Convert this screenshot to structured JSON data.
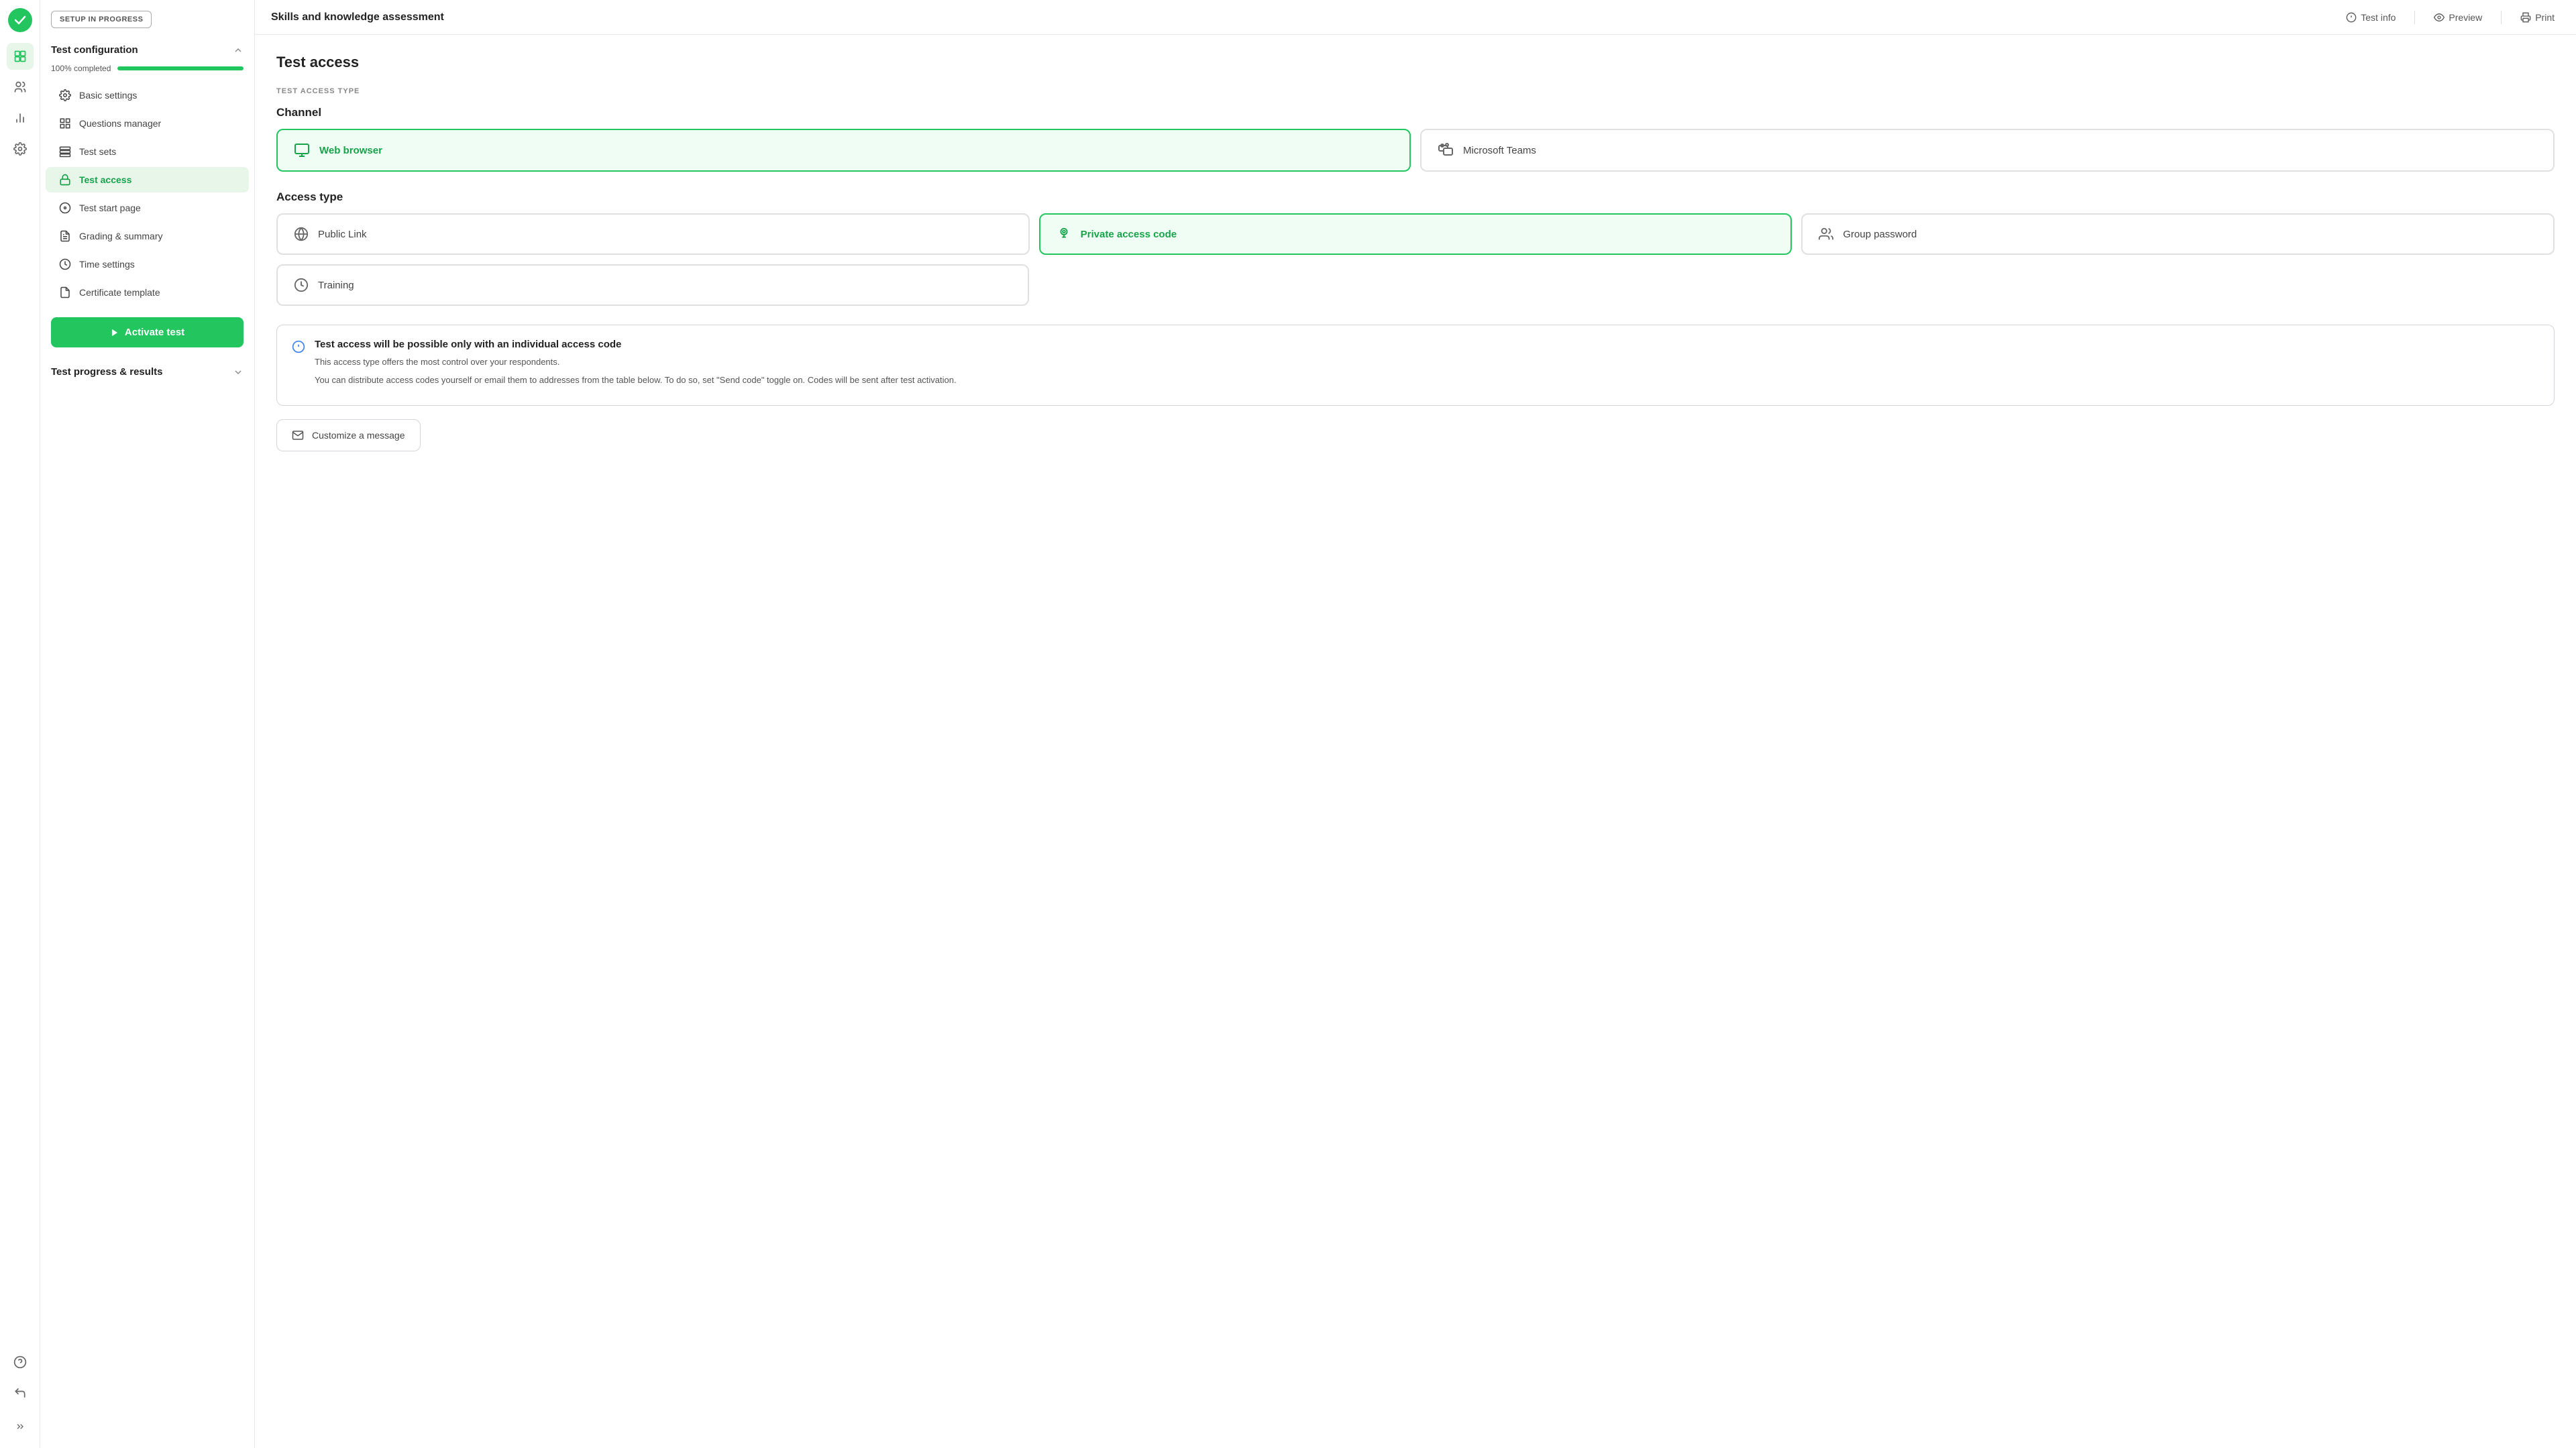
{
  "app": {
    "logo_alt": "Logo checkmark"
  },
  "topbar": {
    "title": "Skills and knowledge assessment",
    "test_info_label": "Test info",
    "preview_label": "Preview",
    "print_label": "Print"
  },
  "sidebar": {
    "setup_badge": "SETUP IN PROGRESS",
    "test_config_title": "Test configuration",
    "progress_label": "100% completed",
    "progress_pct": 100,
    "nav_items": [
      {
        "id": "basic-settings",
        "label": "Basic settings"
      },
      {
        "id": "questions-manager",
        "label": "Questions manager"
      },
      {
        "id": "test-sets",
        "label": "Test sets"
      },
      {
        "id": "test-access",
        "label": "Test access",
        "active": true
      },
      {
        "id": "test-start-page",
        "label": "Test start page"
      },
      {
        "id": "grading-summary",
        "label": "Grading & summary"
      },
      {
        "id": "time-settings",
        "label": "Time settings"
      },
      {
        "id": "certificate-template",
        "label": "Certificate template"
      }
    ],
    "activate_btn_label": "Activate test",
    "test_progress_title": "Test progress & results"
  },
  "main": {
    "page_title": "Test access",
    "section_label": "TEST ACCESS TYPE",
    "channel_label": "Channel",
    "channels": [
      {
        "id": "web-browser",
        "label": "Web browser",
        "selected": true
      },
      {
        "id": "microsoft-teams",
        "label": "Microsoft Teams",
        "selected": false
      }
    ],
    "access_type_label": "Access type",
    "access_types_row1": [
      {
        "id": "public-link",
        "label": "Public Link",
        "selected": false
      },
      {
        "id": "private-access-code",
        "label": "Private access code",
        "selected": true
      },
      {
        "id": "group-password",
        "label": "Group password",
        "selected": false
      }
    ],
    "access_types_row2": [
      {
        "id": "training",
        "label": "Training",
        "selected": false
      }
    ],
    "info_box": {
      "title": "Test access will be possible only with an individual access code",
      "text1": "This access type offers the most control over your respondents.",
      "text2": "You can distribute access codes yourself or email them to addresses from the table below. To do so, set \"Send code\" toggle on. Codes will be sent after test activation."
    },
    "customize_btn_label": "Customize a message"
  },
  "icons": {
    "grid": "⊞",
    "users": "👥",
    "chart": "📊",
    "settings": "⚙",
    "question": "?",
    "back": "←",
    "expand": "»",
    "play": "▶",
    "globe": "🌐",
    "teams": "teams",
    "lock": "🔒",
    "person_check": "👤",
    "group": "👥",
    "training": "⏱",
    "info": "ℹ",
    "message": "✉"
  }
}
